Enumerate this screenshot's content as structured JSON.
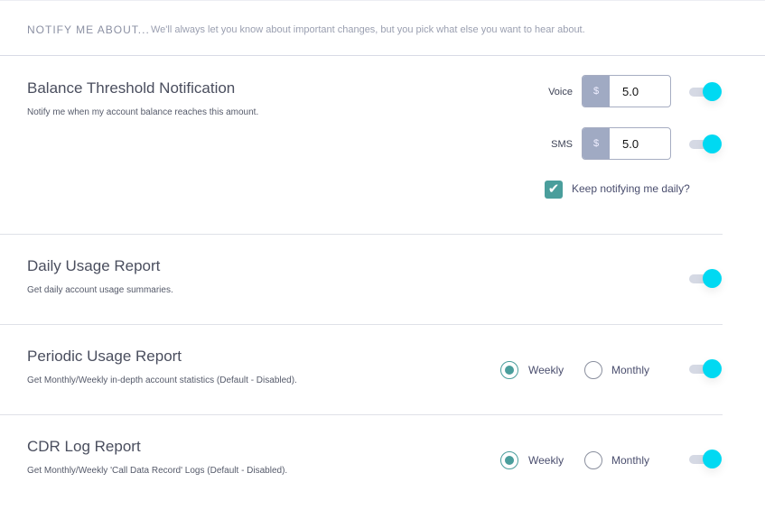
{
  "header": {
    "title": "NOTIFY ME ABOUT...",
    "subtitle": "We'll always let you know about important changes, but you pick what else you want to hear about."
  },
  "balance": {
    "title": "Balance Threshold Notification",
    "description": "Notify me when my account balance reaches this amount.",
    "voice_label": "Voice",
    "sms_label": "SMS",
    "currency": "$",
    "voice_value": "5.0",
    "sms_value": "5.0",
    "voice_enabled": true,
    "sms_enabled": true,
    "daily_label": "Keep notifying me daily?",
    "daily_checked": true
  },
  "daily": {
    "title": "Daily Usage Report",
    "description": "Get daily account usage summaries.",
    "enabled": true
  },
  "periodic": {
    "title": "Periodic Usage Report",
    "description": "Get Monthly/Weekly in-depth account statistics (Default - Disabled).",
    "weekly": "Weekly",
    "monthly": "Monthly",
    "selected": "Weekly",
    "enabled": true
  },
  "cdr": {
    "title": "CDR Log Report",
    "description": "Get Monthly/Weekly 'Call Data Record' Logs (Default - Disabled).",
    "weekly": "Weekly",
    "monthly": "Monthly",
    "selected": "Weekly",
    "enabled": true
  },
  "colors": {
    "accent": "#00d9f2",
    "check": "#4a9e9c"
  }
}
